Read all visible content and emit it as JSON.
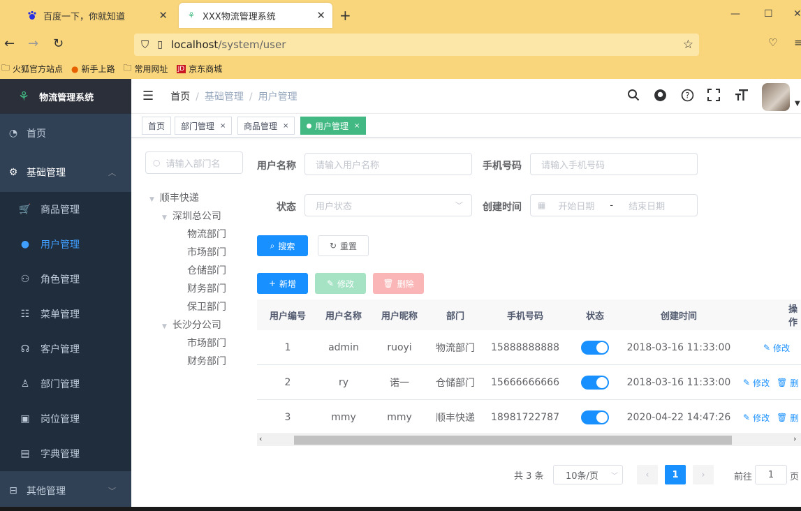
{
  "browser": {
    "tabs": [
      {
        "title": "百度一下，你就知道",
        "icon": "baidu-paw-icon"
      },
      {
        "title": "XXX物流管理系统",
        "icon": "leaf-icon"
      }
    ],
    "url_host": "localhost",
    "url_path": "/system/user",
    "bookmarks": [
      "火狐官方站点",
      "新手上路",
      "常用网址",
      "京东商城"
    ],
    "bookmark_jd_badge": "JD"
  },
  "sidebar": {
    "title": "物流管理系统",
    "items": [
      {
        "label": "首页",
        "icon": "dashboard-icon"
      },
      {
        "label": "基础管理",
        "icon": "gear-icon"
      },
      {
        "label": "商品管理",
        "icon": "cart-icon"
      },
      {
        "label": "用户管理",
        "icon": "user-icon"
      },
      {
        "label": "角色管理",
        "icon": "users-icon"
      },
      {
        "label": "菜单管理",
        "icon": "tree-table-icon"
      },
      {
        "label": "客户管理",
        "icon": "customer-icon"
      },
      {
        "label": "部门管理",
        "icon": "org-icon"
      },
      {
        "label": "岗位管理",
        "icon": "post-icon"
      },
      {
        "label": "字典管理",
        "icon": "dict-icon"
      },
      {
        "label": "其他管理",
        "icon": "briefcase-icon"
      }
    ]
  },
  "header": {
    "breadcrumb": [
      "首页",
      "基础管理",
      "用户管理"
    ]
  },
  "tagsview": [
    {
      "label": "首页",
      "closable": false
    },
    {
      "label": "部门管理",
      "closable": true
    },
    {
      "label": "商品管理",
      "closable": true
    },
    {
      "label": "用户管理",
      "closable": true,
      "active": true
    }
  ],
  "tag_close": "×",
  "tree": {
    "search_placeholder": "请输入部门名",
    "nodes": {
      "root": "顺丰快递",
      "sz": "深圳总公司",
      "sz_children": [
        "物流部门",
        "市场部门",
        "仓储部门",
        "财务部门",
        "保卫部门"
      ],
      "cs": "长沙分公司",
      "cs_children": [
        "市场部门",
        "财务部门"
      ]
    }
  },
  "form": {
    "username_label": "用户名称",
    "username_placeholder": "请输入用户名称",
    "phone_label": "手机号码",
    "phone_placeholder": "请输入手机号码",
    "status_label": "状态",
    "status_placeholder": "用户状态",
    "created_label": "创建时间",
    "start_placeholder": "开始日期",
    "range_sep": "-",
    "end_placeholder": "结束日期",
    "search_btn": "搜索",
    "reset_btn": "重置"
  },
  "toolbar": {
    "add": "新增",
    "edit": "修改",
    "delete": "删除"
  },
  "table": {
    "columns": [
      "用户编号",
      "用户名称",
      "用户昵称",
      "部门",
      "手机号码",
      "状态",
      "创建时间",
      "操作"
    ],
    "rows": [
      {
        "id": "1",
        "username": "admin",
        "nickname": "ruoyi",
        "dept": "物流部门",
        "phone": "15888888888",
        "status_on": true,
        "created": "2018-03-16 11:33:00",
        "ops": [
          "修改"
        ]
      },
      {
        "id": "2",
        "username": "ry",
        "nickname": "诺一",
        "dept": "仓储部门",
        "phone": "15666666666",
        "status_on": true,
        "created": "2018-03-16 11:33:00",
        "ops": [
          "修改",
          "删"
        ]
      },
      {
        "id": "3",
        "username": "mmy",
        "nickname": "mmy",
        "dept": "顺丰快递",
        "phone": "18981722787",
        "status_on": true,
        "created": "2020-04-22 14:47:26",
        "ops": [
          "修改",
          "删"
        ]
      }
    ]
  },
  "pagination": {
    "total": "共 3 条",
    "page_size": "10条/页",
    "current": "1",
    "goto_prefix": "前往",
    "goto_value": "1",
    "goto_suffix": "页"
  },
  "colors": {
    "sidebar_bg": "#304156",
    "primary": "#1890ff",
    "tag_active": "#42b983",
    "browser_chrome": "#f9d57b"
  }
}
